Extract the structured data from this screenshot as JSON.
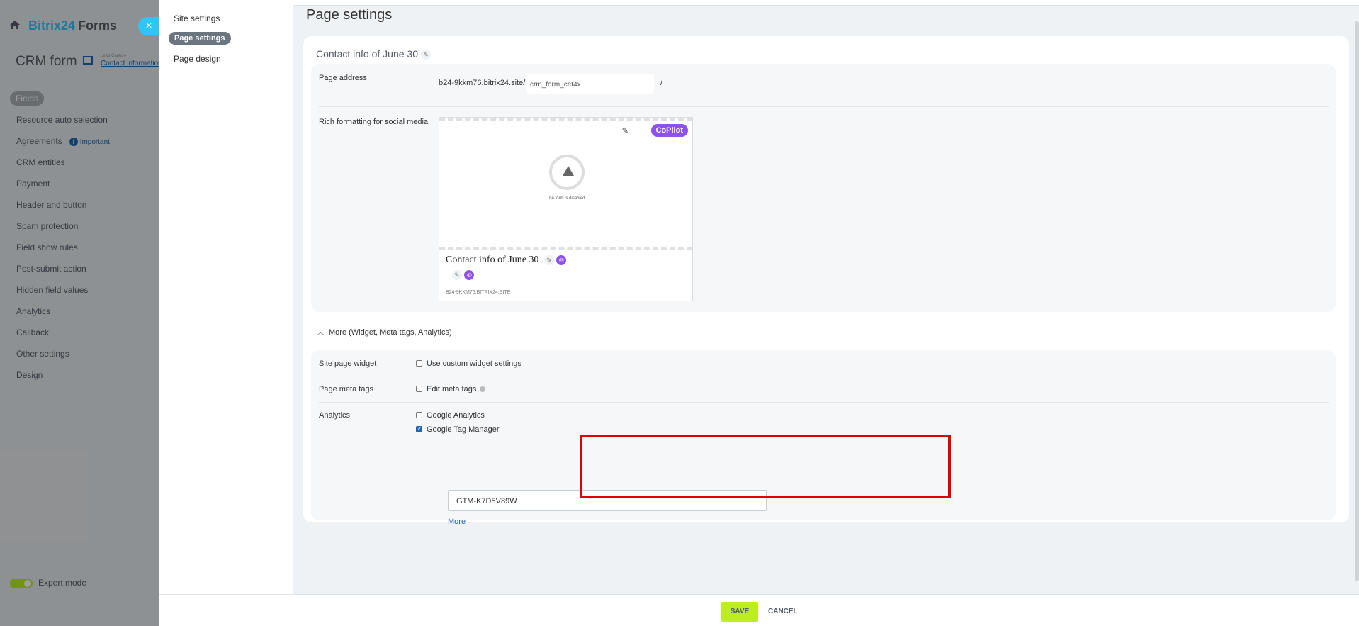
{
  "background_app": {
    "brand": "Bitrix24",
    "brand_suffix": "Forms",
    "close_glyph": "×",
    "crm_title": "CRM form",
    "crm_sub_small": "Lead Capture",
    "crm_sub": "Contact information",
    "nav": [
      {
        "label": "Fields"
      },
      {
        "label": "Resource auto selection"
      },
      {
        "label": "Agreements",
        "badge": "Important"
      },
      {
        "label": "CRM entities"
      },
      {
        "label": "Payment"
      },
      {
        "label": "Header and button"
      },
      {
        "label": "Spam protection"
      },
      {
        "label": "Field show rules"
      },
      {
        "label": "Post-submit action"
      },
      {
        "label": "Hidden field values"
      },
      {
        "label": "Analytics"
      },
      {
        "label": "Callback"
      },
      {
        "label": "Other settings"
      },
      {
        "label": "Design"
      }
    ],
    "expert_mode": "Expert mode"
  },
  "left_menu": {
    "items": [
      "Site settings",
      "Page settings",
      "Page design"
    ]
  },
  "page_title": "Page settings",
  "contact_title": "Contact info of June 30",
  "page_address": {
    "label": "Page address",
    "prefix": "b24-9kkm76.bitrix24.site/",
    "value": "crm_form_cet4x",
    "suffix": "/"
  },
  "rich_formatting": {
    "label": "Rich formatting for social media",
    "copilot": "CoPilot",
    "disabled_text": "The form is disabled",
    "preview_title": "Contact info of June 30",
    "site": "B24-9KKM76.BITRIX24.SITE"
  },
  "more_toggle": {
    "label": "More",
    "detail": "(Widget, Meta tags, Analytics)"
  },
  "widget": {
    "label": "Site page widget",
    "checkbox": "Use custom widget settings"
  },
  "meta_tags": {
    "label": "Page meta tags",
    "checkbox": "Edit meta tags"
  },
  "analytics": {
    "label": "Analytics",
    "ga": "Google Analytics",
    "gtm": "Google Tag Manager",
    "gtm_value": "GTM-K7D5V89W",
    "more": "More"
  },
  "footer": {
    "save": "SAVE",
    "cancel": "CANCEL"
  },
  "colors": {
    "accent": "#2fc6f6",
    "save_green": "#bbed21",
    "copilot_purple": "#8e52ec",
    "highlight_red": "#e30000",
    "link_blue": "#2066b0"
  }
}
